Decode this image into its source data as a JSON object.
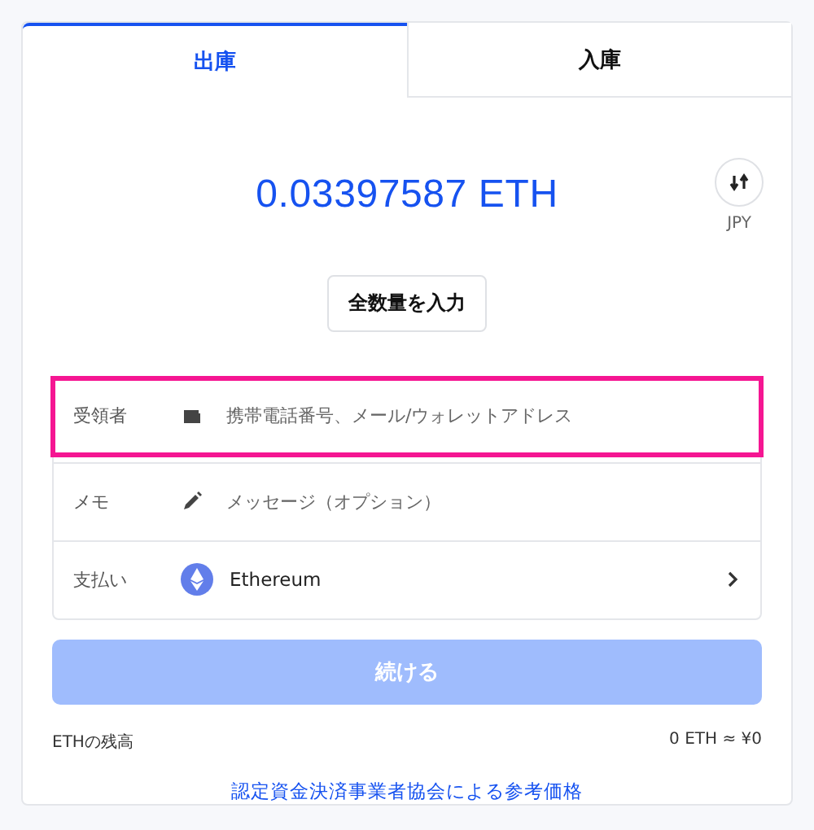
{
  "tabs": [
    {
      "label": "出庫",
      "selected": true
    },
    {
      "label": "入庫",
      "selected": false
    }
  ],
  "amount": {
    "value": "0.03397587",
    "unit": "ETH"
  },
  "currency_toggle": {
    "label": "JPY"
  },
  "max_button": "全数量を入力",
  "fields": [
    {
      "kind": "recipient",
      "label": "受領者",
      "placeholder": "携帯電話番号、メール/ウォレットアドレス",
      "highlighted": true
    },
    {
      "kind": "memo",
      "label": "メモ",
      "placeholder": "メッセージ（オプション）",
      "highlighted": false
    },
    {
      "kind": "payment",
      "label": "支払い",
      "value": "Ethereum",
      "highlighted": false
    }
  ],
  "continue_button": {
    "label": "続ける",
    "disabled": true
  },
  "balance": {
    "label": "ETHの残高",
    "value": "0 ETH ≈ ¥0"
  },
  "reference_link": "認定資金決済事業者協会による参考価格"
}
